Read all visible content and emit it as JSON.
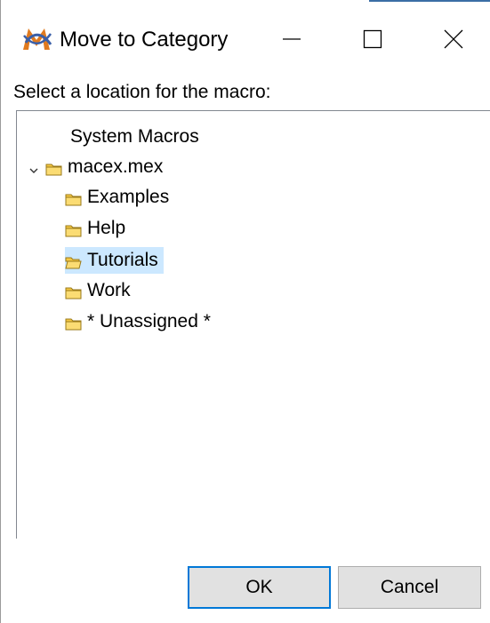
{
  "window": {
    "title": "Move to Category",
    "app_icon": "macro-m-logo-icon",
    "controls": [
      "minimize-icon",
      "maximize-icon",
      "close-icon"
    ]
  },
  "prompt": "Select a location for the macro:",
  "tree": {
    "root_item": "System Macros",
    "group": {
      "label": "macex.mex",
      "expanded": true,
      "children": [
        {
          "label": "Examples",
          "selected": false
        },
        {
          "label": "Help",
          "selected": false
        },
        {
          "label": "Tutorials",
          "selected": true
        },
        {
          "label": "Work",
          "selected": false
        },
        {
          "label": "* Unassigned *",
          "selected": false
        }
      ]
    }
  },
  "buttons": {
    "ok": "OK",
    "cancel": "Cancel"
  },
  "colors": {
    "selection": "#cce8ff",
    "folder": "#f5c842",
    "default_button_border": "#0078d7",
    "logo_primary": "#e07a1f",
    "logo_secondary": "#3a5fa8"
  }
}
